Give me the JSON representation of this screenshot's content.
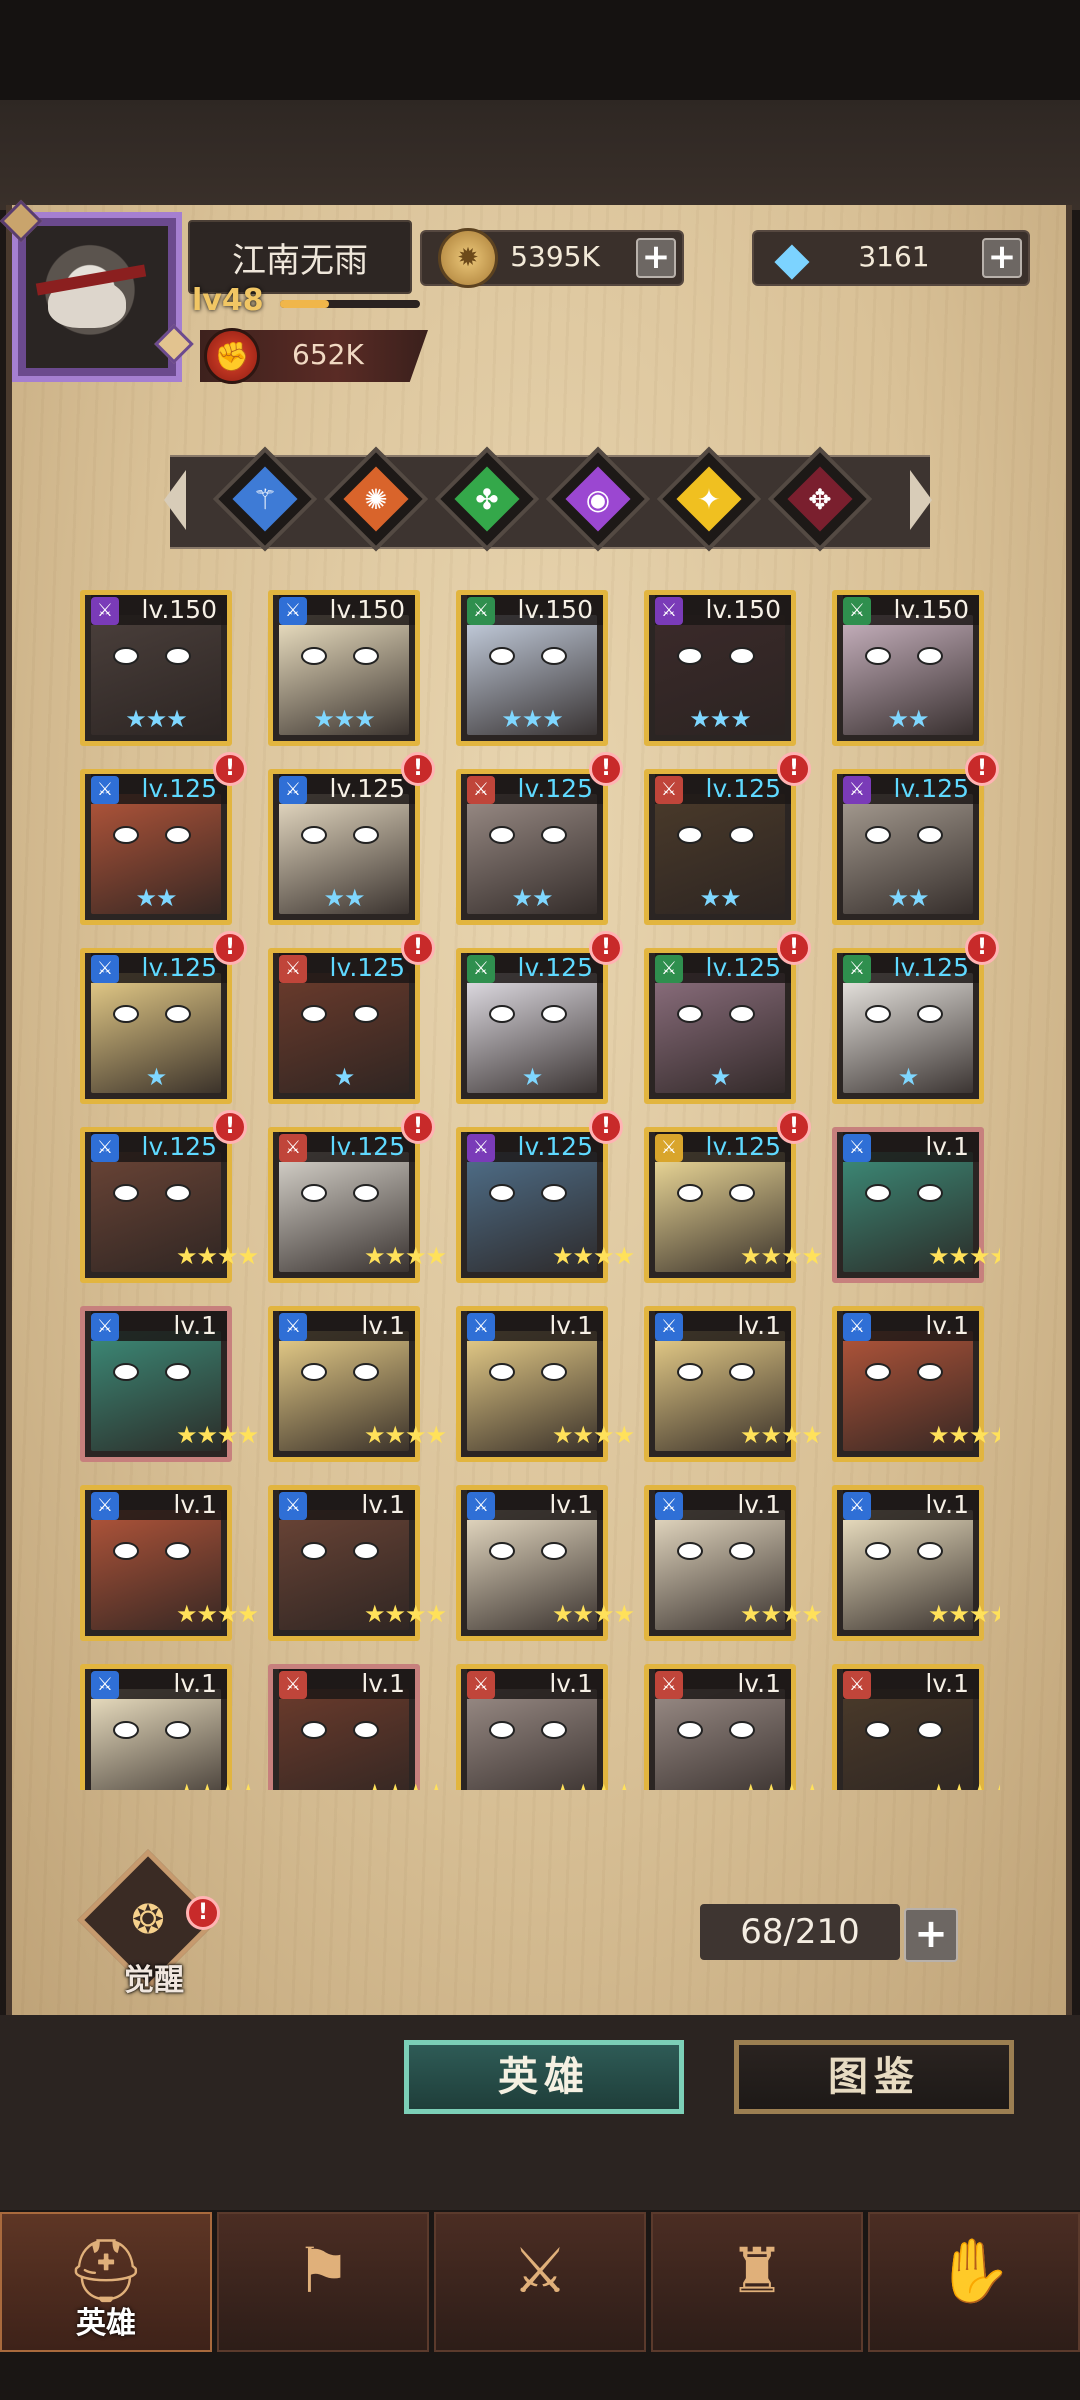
{
  "player": {
    "name": "江南无雨",
    "level": "lv48",
    "level_progress": 0.35,
    "power": "652K"
  },
  "currency": {
    "gold": "5395K",
    "gems": "3161",
    "plus": "+"
  },
  "filters": [
    {
      "name": "class-filter-blue",
      "color": "#3e7bd6"
    },
    {
      "name": "class-filter-orange",
      "color": "#d9642b"
    },
    {
      "name": "class-filter-green",
      "color": "#34a84a"
    },
    {
      "name": "class-filter-purple",
      "color": "#9b47d1"
    },
    {
      "name": "class-filter-yellow",
      "color": "#f0c020"
    },
    {
      "name": "class-filter-darkred",
      "color": "#7a1f2e"
    }
  ],
  "heroes": [
    {
      "level": "lv.150",
      "stars": "★★★",
      "star_color": "blue",
      "cls": "#7a3bb8",
      "face": "#4a3f3b",
      "alert": false,
      "frame": "gold"
    },
    {
      "level": "lv.150",
      "stars": "★★★",
      "star_color": "blue",
      "cls": "#2f6fd6",
      "face": "#efe3c4",
      "alert": false,
      "frame": "gold"
    },
    {
      "level": "lv.150",
      "stars": "★★★",
      "star_color": "blue",
      "cls": "#2f8f4e",
      "face": "#c6d0e0",
      "alert": false,
      "frame": "gold"
    },
    {
      "level": "lv.150",
      "stars": "★★★",
      "star_color": "blue",
      "cls": "#7a3bb8",
      "face": "#3b2a2a",
      "alert": false,
      "frame": "gold"
    },
    {
      "level": "lv.150",
      "stars": "★★",
      "star_color": "blue",
      "cls": "#2f8f4e",
      "face": "#c9b3c0",
      "alert": false,
      "frame": "gold"
    },
    {
      "level": "lv.125",
      "stars": "★★",
      "star_color": "blue",
      "cls": "#2f6fd6",
      "face": "#b2553a",
      "alert": true,
      "frame": "gold",
      "lv_blue": true
    },
    {
      "level": "lv.125",
      "stars": "★★",
      "star_color": "blue",
      "cls": "#2f6fd6",
      "face": "#e8dcc4",
      "alert": true,
      "frame": "gold"
    },
    {
      "level": "lv.125",
      "stars": "★★",
      "star_color": "blue",
      "cls": "#c0453a",
      "face": "#9a8c86",
      "alert": true,
      "frame": "gold",
      "lv_blue": true
    },
    {
      "level": "lv.125",
      "stars": "★★",
      "star_color": "blue",
      "cls": "#c0453a",
      "face": "#4a3a2a",
      "alert": true,
      "frame": "gold",
      "lv_blue": true
    },
    {
      "level": "lv.125",
      "stars": "★★",
      "star_color": "blue",
      "cls": "#7a3bb8",
      "face": "#a79d92",
      "alert": true,
      "frame": "gold",
      "lv_blue": true
    },
    {
      "level": "lv.125",
      "stars": "★",
      "star_color": "blue",
      "cls": "#2f6fd6",
      "face": "#e9cf8a",
      "alert": true,
      "frame": "gold",
      "lv_blue": true
    },
    {
      "level": "lv.125",
      "stars": "★",
      "star_color": "blue",
      "cls": "#c0453a",
      "face": "#6b3b2c",
      "alert": true,
      "frame": "gold",
      "lv_blue": true
    },
    {
      "level": "lv.125",
      "stars": "★",
      "star_color": "blue",
      "cls": "#2f8f4e",
      "face": "#e4e1e8",
      "alert": true,
      "frame": "gold",
      "lv_blue": true
    },
    {
      "level": "lv.125",
      "stars": "★",
      "star_color": "blue",
      "cls": "#2f8f4e",
      "face": "#8c6f7e",
      "alert": true,
      "frame": "gold",
      "lv_blue": true
    },
    {
      "level": "lv.125",
      "stars": "★",
      "star_color": "blue",
      "cls": "#2f8f4e",
      "face": "#ece9e4",
      "alert": true,
      "frame": "gold",
      "lv_blue": true
    },
    {
      "level": "lv.125",
      "stars": "★★★★",
      "star_color": "gold",
      "cls": "#2f6fd6",
      "face": "#6a4436",
      "alert": true,
      "frame": "gold",
      "lv_blue": true
    },
    {
      "level": "lv.125",
      "stars": "★★★★",
      "star_color": "gold",
      "cls": "#c0453a",
      "face": "#d8d4cc",
      "alert": true,
      "frame": "gold",
      "lv_blue": true
    },
    {
      "level": "lv.125",
      "stars": "★★★★",
      "star_color": "gold",
      "cls": "#7a3bb8",
      "face": "#4f6f8a",
      "alert": true,
      "frame": "gold",
      "lv_blue": true
    },
    {
      "level": "lv.125",
      "stars": "★★★★",
      "star_color": "gold",
      "cls": "#d9a52c",
      "face": "#f0dc9a",
      "alert": true,
      "frame": "gold",
      "lv_blue": true
    },
    {
      "level": "lv.1",
      "stars": "★★★★",
      "star_color": "gold",
      "cls": "#2f6fd6",
      "face": "#3c8b78",
      "alert": false,
      "frame": "pink"
    },
    {
      "level": "lv.1",
      "stars": "★★★★",
      "star_color": "gold",
      "cls": "#2f6fd6",
      "face": "#3c8b78",
      "alert": false,
      "frame": "pink"
    },
    {
      "level": "lv.1",
      "stars": "★★★★",
      "star_color": "gold",
      "cls": "#2f6fd6",
      "face": "#e9cf8a",
      "alert": false,
      "frame": "gold"
    },
    {
      "level": "lv.1",
      "stars": "★★★★",
      "star_color": "gold",
      "cls": "#2f6fd6",
      "face": "#e9cf8a",
      "alert": false,
      "frame": "gold"
    },
    {
      "level": "lv.1",
      "stars": "★★★★",
      "star_color": "gold",
      "cls": "#2f6fd6",
      "face": "#e9cf8a",
      "alert": false,
      "frame": "gold"
    },
    {
      "level": "lv.1",
      "stars": "★★★★",
      "star_color": "gold",
      "cls": "#2f6fd6",
      "face": "#b2553a",
      "alert": false,
      "frame": "gold"
    },
    {
      "level": "lv.1",
      "stars": "★★★★",
      "star_color": "gold",
      "cls": "#2f6fd6",
      "face": "#b2553a",
      "alert": false,
      "frame": "gold"
    },
    {
      "level": "lv.1",
      "stars": "★★★★",
      "star_color": "gold",
      "cls": "#2f6fd6",
      "face": "#6a4436",
      "alert": false,
      "frame": "gold"
    },
    {
      "level": "lv.1",
      "stars": "★★★★",
      "star_color": "gold",
      "cls": "#2f6fd6",
      "face": "#e8dcc4",
      "alert": false,
      "frame": "gold"
    },
    {
      "level": "lv.1",
      "stars": "★★★★",
      "star_color": "gold",
      "cls": "#2f6fd6",
      "face": "#e8dcc4",
      "alert": false,
      "frame": "gold"
    },
    {
      "level": "lv.1",
      "stars": "★★★★",
      "star_color": "gold",
      "cls": "#2f6fd6",
      "face": "#efe3c4",
      "alert": false,
      "frame": "gold"
    },
    {
      "level": "lv.1",
      "stars": "★★★★",
      "star_color": "gold",
      "cls": "#2f6fd6",
      "face": "#efe3c4",
      "alert": false,
      "frame": "gold"
    },
    {
      "level": "lv.1",
      "stars": "★★★★",
      "star_color": "gold",
      "cls": "#c0453a",
      "face": "#6b3b2c",
      "alert": false,
      "frame": "pink"
    },
    {
      "level": "lv.1",
      "stars": "★★★★",
      "star_color": "gold",
      "cls": "#c0453a",
      "face": "#9a8c86",
      "alert": false,
      "frame": "gold"
    },
    {
      "level": "lv.1",
      "stars": "★★★★",
      "star_color": "gold",
      "cls": "#c0453a",
      "face": "#9a8c86",
      "alert": false,
      "frame": "gold"
    },
    {
      "level": "lv.1",
      "stars": "★★★★",
      "star_color": "gold",
      "cls": "#c0453a",
      "face": "#4a3a2a",
      "alert": false,
      "frame": "gold"
    }
  ],
  "awaken": {
    "label": "觉醒"
  },
  "capacity": {
    "value": "68/210",
    "plus": "+"
  },
  "tabs": {
    "hero": "英雄",
    "atlas": "图鉴"
  },
  "nav": [
    {
      "label": "英雄",
      "icon": "helmet-icon",
      "active": true
    },
    {
      "label": "",
      "icon": "flag-icon",
      "active": false
    },
    {
      "label": "",
      "icon": "crossed-swords-icon",
      "active": false
    },
    {
      "label": "",
      "icon": "castle-icon",
      "active": false
    },
    {
      "label": "",
      "icon": "handshake-icon",
      "active": false
    }
  ]
}
